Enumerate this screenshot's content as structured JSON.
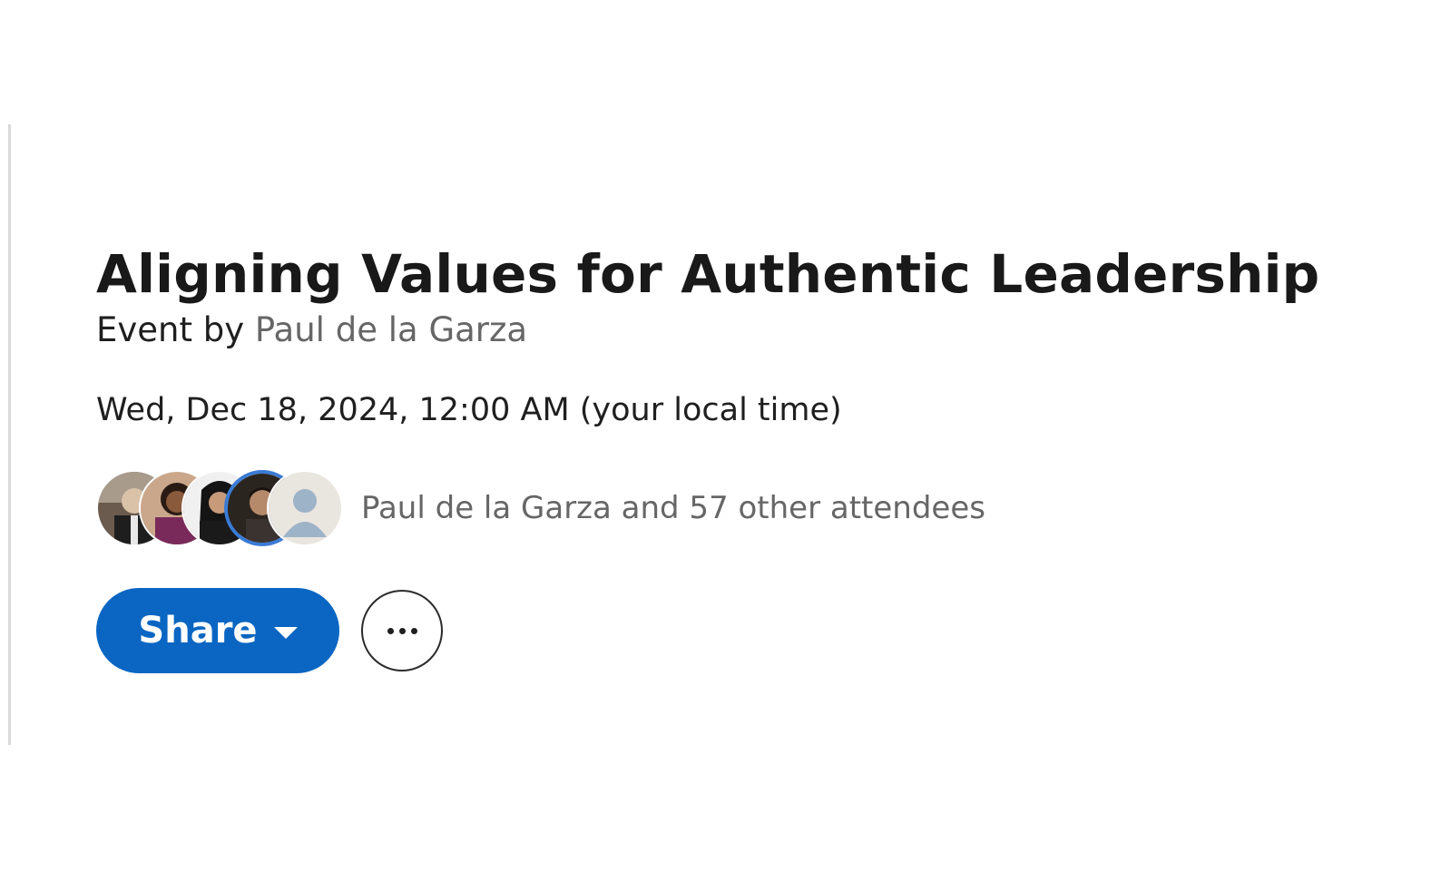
{
  "event": {
    "title": "Aligning Values for Authentic Leadership",
    "organizer_prefix": "Event by",
    "organizer_name": "Paul de la Garza",
    "datetime": "Wed, Dec 18, 2024, 12:00 AM (your local time)",
    "attendees_text": "Paul de la Garza and 57 other attendees"
  },
  "avatars": [
    {
      "name": "attendee-avatar-1"
    },
    {
      "name": "attendee-avatar-2"
    },
    {
      "name": "attendee-avatar-3"
    },
    {
      "name": "attendee-avatar-4"
    },
    {
      "name": "attendee-avatar-placeholder"
    }
  ],
  "actions": {
    "share_label": "Share",
    "share_icon": "caret-down-icon",
    "more_icon": "ellipsis-icon"
  },
  "colors": {
    "primary": "#0a66c2",
    "title_text": "#191919",
    "muted_text": "#666666"
  }
}
